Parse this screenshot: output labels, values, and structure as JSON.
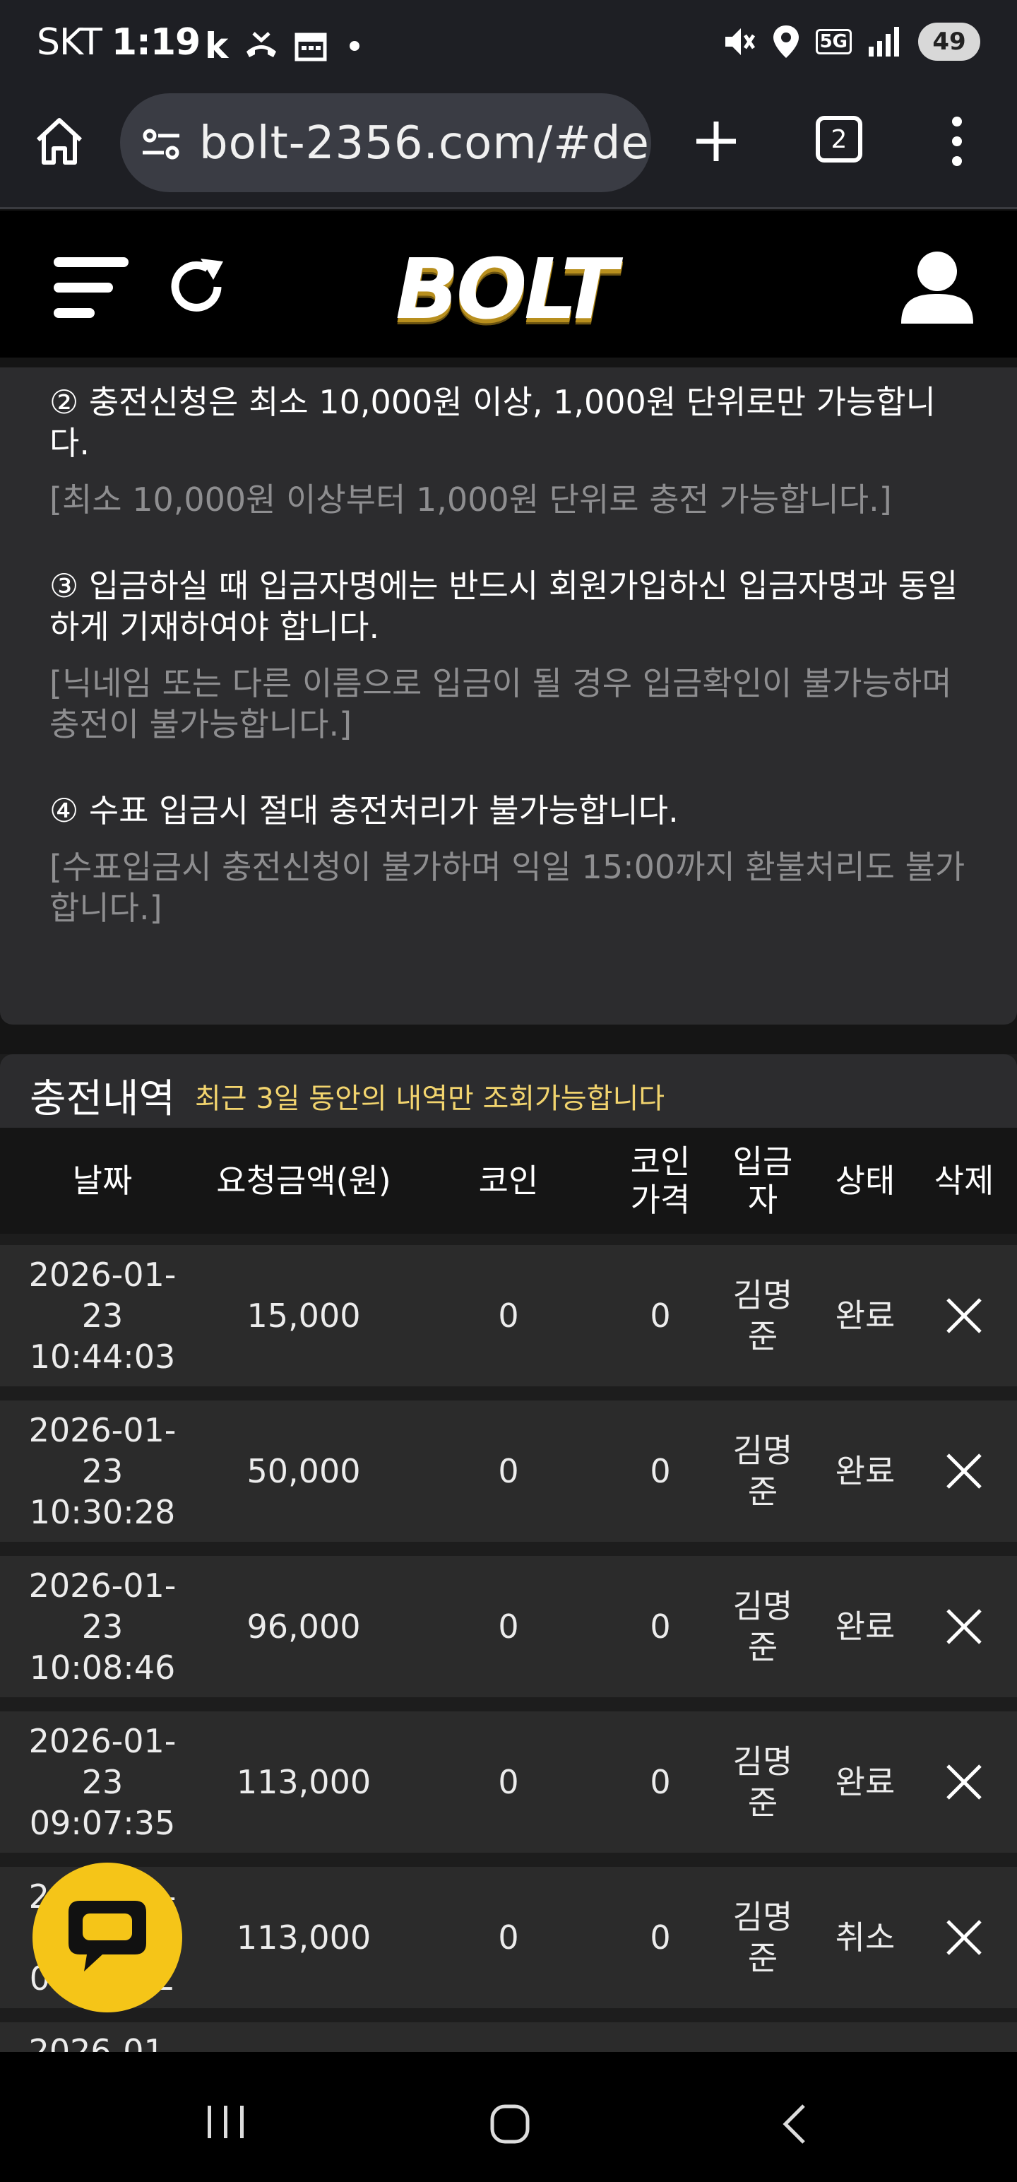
{
  "status_bar": {
    "carrier": "SKT",
    "time": "1:19",
    "app_icons": [
      "k-icon",
      "missed-call-icon",
      "calendar-icon",
      "dot-icon"
    ],
    "network": "5G",
    "battery": "49"
  },
  "browser": {
    "url": "bolt-2356.com/#de",
    "tab_count": "2"
  },
  "site": {
    "logo": "BOLT"
  },
  "notice": {
    "items": [
      {
        "main": "② 충전신청은 최소 10,000원 이상, 1,000원 단위로만 가능합니다.",
        "sub": "[최소 10,000원 이상부터 1,000원 단위로 충전 가능합니다.]"
      },
      {
        "main": "③ 입금하실 때 입금자명에는 반드시 회원가입하신 입금자명과 동일하게 기재하여야 합니다.",
        "sub": "[닉네임 또는 다른 이름으로 입금이 될 경우 입금확인이 불가능하며 충전이 불가능합니다.]"
      },
      {
        "main": "④ 수표 입금시 절대 충전처리가 불가능합니다.",
        "sub": "[수표입금시 충전신청이 불가하며 익일 15:00까지 환불처리도 불가합니다.]"
      }
    ]
  },
  "history": {
    "title": "충전내역",
    "subtitle": "최근 3일 동안의 내역만 조회가능합니다",
    "columns": [
      "날짜",
      "요청금액(원)",
      "코인",
      "코인\n가격",
      "입금\n자",
      "상태",
      "삭제"
    ],
    "rows": [
      {
        "date": "2026-01-\n23\n10:44:03",
        "amount": "15,000",
        "coin": "0",
        "coin_price": "0",
        "depositor": "김명\n준",
        "status": "완료"
      },
      {
        "date": "2026-01-\n23\n10:30:28",
        "amount": "50,000",
        "coin": "0",
        "coin_price": "0",
        "depositor": "김명\n준",
        "status": "완료"
      },
      {
        "date": "2026-01-\n23\n10:08:46",
        "amount": "96,000",
        "coin": "0",
        "coin_price": "0",
        "depositor": "김명\n준",
        "status": "완료"
      },
      {
        "date": "2026-01-\n23\n09:07:35",
        "amount": "113,000",
        "coin": "0",
        "coin_price": "0",
        "depositor": "김명\n준",
        "status": "완료"
      },
      {
        "date": "2026-01-\n23\n09:07:22",
        "amount": "113,000",
        "coin": "0",
        "coin_price": "0",
        "depositor": "김명\n준",
        "status": "취소"
      },
      {
        "date": "2026-01-",
        "amount": "",
        "coin": "",
        "coin_price": "",
        "depositor": "",
        "status": ""
      }
    ]
  },
  "colors": {
    "accent_yellow": "#f5c518",
    "subtitle_yellow": "#f2d46e",
    "notice_bg": "#2c2c2e",
    "row_bg": "#2b2b2b"
  }
}
